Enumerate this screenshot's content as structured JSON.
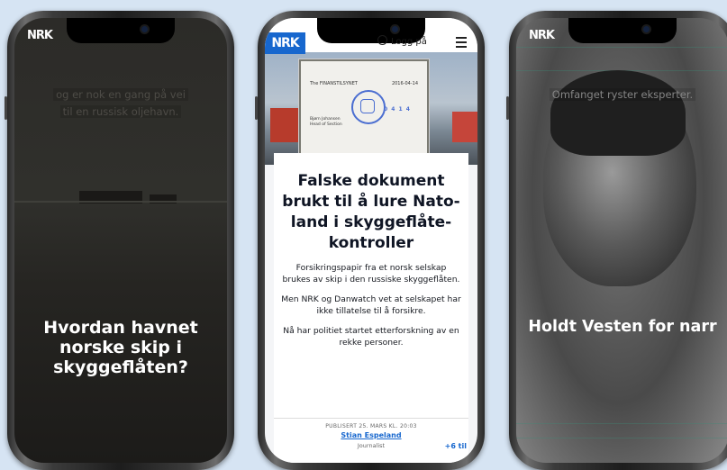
{
  "phone1": {
    "logo": "NRK",
    "caption_line1": "og er nok en gang på vei",
    "caption_line2": "til en russisk oljehavn.",
    "title": "Hvordan havnet norske skip i skyggeflåten?"
  },
  "phone2": {
    "logo": "NRK",
    "login_label": "Logg på",
    "document": {
      "sender": "The FINANSTILSYNET",
      "date": "2016-04-14",
      "signature_name": "Bjørn Johansen",
      "signature_title": "Head of Section",
      "stamp_number": "0 4 1 4"
    },
    "headline": "Falske dokument brukt til å lure Nato-land i skyggeflåte-kontroller",
    "paragraphs": [
      "Forsikringspapir fra et norsk selskap brukes av skip i den russiske skyggeflåten.",
      "Men NRK og Danwatch vet at selskapet har ikke tillatelse til å forsikre.",
      "Nå har politiet startet etterforskning av en rekke personer."
    ],
    "published": "PUBLISERT 25. MARS KL. 20:03",
    "author": "Stian Espeland",
    "role": "Journalist",
    "more_authors": "+6 til"
  },
  "phone3": {
    "logo": "NRK",
    "caption": "Omfanget ryster eksperter.",
    "title": "Holdt Vesten for narr"
  },
  "colors": {
    "background": "#d6e4f3",
    "nrk_blue": "#1767ce"
  }
}
